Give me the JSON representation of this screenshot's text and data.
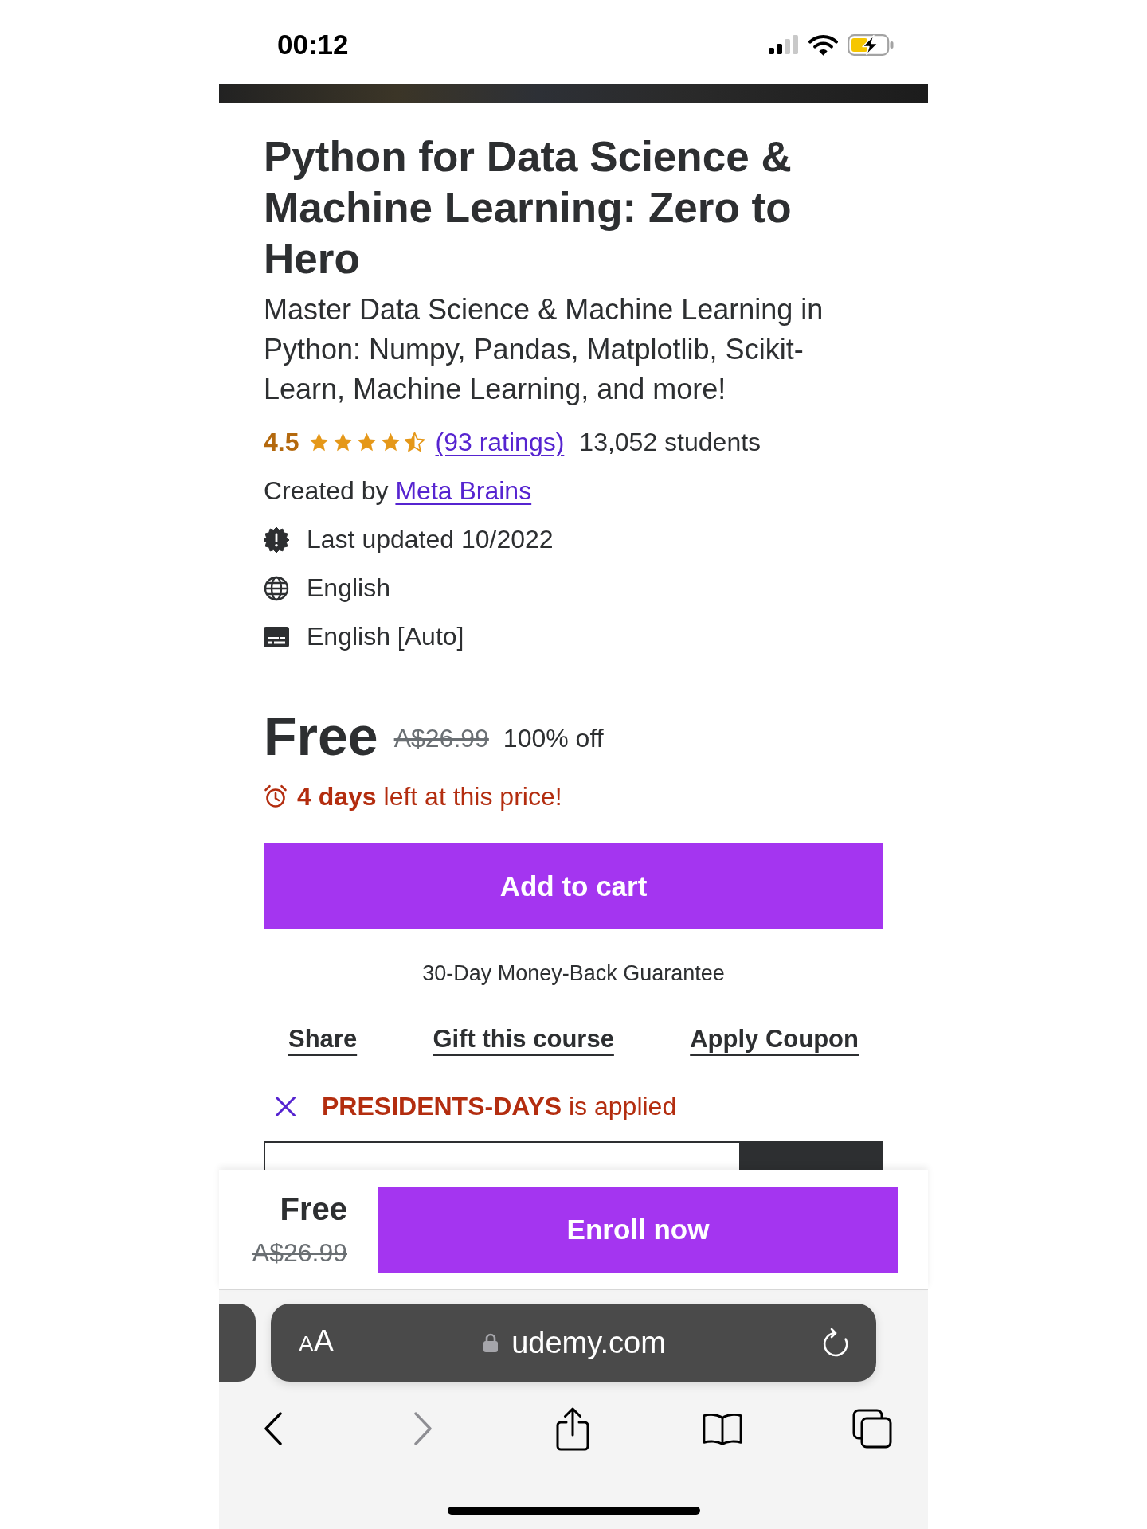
{
  "status_bar": {
    "time": "00:12"
  },
  "course": {
    "title": "Python for Data Science & Machine Learning: Zero to Hero",
    "subtitle": "Master Data Science & Machine Learning in Python: Numpy, Pandas, Matplotlib, Scikit-Learn, Machine Learning, and more!",
    "rating": {
      "score": "4.5",
      "stars": 4.5,
      "count_link": "(93 ratings)",
      "students": "13,052 students"
    },
    "created_by": {
      "label": "Created by",
      "author": "Meta Brains"
    },
    "details": [
      {
        "kind": "updated",
        "text": "Last updated 10/2022"
      },
      {
        "kind": "language",
        "text": "English"
      },
      {
        "kind": "captions",
        "text": "English [Auto]"
      }
    ]
  },
  "pricing": {
    "price": "Free",
    "original_price": "A$26.99",
    "discount": "100% off",
    "countdown": "**4 days** left at this price!",
    "add_to_cart": "Add to cart",
    "guarantee": "30-Day Money-Back Guarantee"
  },
  "actions": [
    "Share",
    "Gift this course",
    "Apply Coupon"
  ],
  "coupon": {
    "message": "**PRESIDENTS-DAYS** is applied"
  },
  "purchase_bar": {
    "price": "Free",
    "original_price": "A$26.99",
    "button": "Enroll now"
  },
  "browser": {
    "text_size_button": "AA",
    "url": "udemy.com",
    "toolbar": [
      {
        "kind": "back",
        "disabled": false
      },
      {
        "kind": "forward",
        "disabled": true
      },
      {
        "kind": "share",
        "disabled": false
      },
      {
        "kind": "bookmarks",
        "disabled": false
      },
      {
        "kind": "tabs",
        "disabled": false
      }
    ]
  }
}
